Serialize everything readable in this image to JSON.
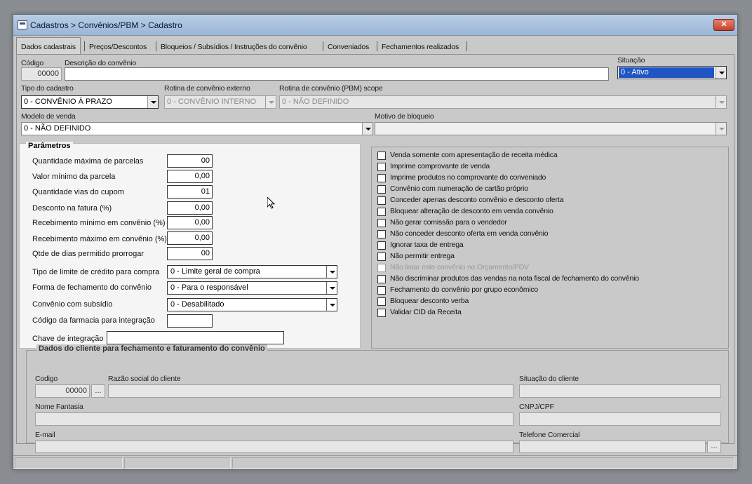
{
  "window": {
    "title": "Cadastros > Convênios/PBM > Cadastro",
    "close": "✕"
  },
  "tabs": [
    {
      "label": "Dados cadastrais"
    },
    {
      "label": "Preços/Descontos"
    },
    {
      "label": "Bloqueios / Subsídios / Instruções do convênio"
    },
    {
      "label": "Conveniados"
    },
    {
      "label": "Fechamentos realizados"
    }
  ],
  "top": {
    "codigo_label": "Código",
    "codigo_value": "00000",
    "descricao_label": "Descrição do convênio",
    "descricao_value": "",
    "situacao_label": "Situação",
    "situacao_value": "0 - Ativo",
    "tipo_label": "Tipo do cadastro",
    "tipo_value": "0 - CONVÊNIO À PRAZO",
    "rotina_ext_label": "Rotina de convênio externo",
    "rotina_ext_value": "0 - CONVÊNIO INTERNO",
    "rotina_pbm_label": "Rotina de convênio (PBM) scope",
    "rotina_pbm_value": "0 - NÃO DEFINIDO",
    "modelo_label": "Modelo de venda",
    "modelo_value": "0 - NÃO DEFINIDO",
    "motivo_label": "Motivo de bloqueio",
    "motivo_value": ""
  },
  "params": {
    "title": "Parâmetros",
    "qtd_parcelas_label": "Quantidade máxima de parcelas",
    "qtd_parcelas_value": "00",
    "valor_min_label": "Valor mínimo da parcela",
    "valor_min_value": "0,00",
    "vias_label": "Quantidade vias do cupom",
    "vias_value": "01",
    "desconto_label": "Desconto na fatura (%)",
    "desconto_value": "0,00",
    "receb_min_label": "Recebimento mínimo em convênio (%)",
    "receb_min_value": "0,00",
    "receb_max_label": "Recebimento máximo em convênio (%)",
    "receb_max_value": "0,00",
    "dias_label": "Qtde de dias permitido prorrogar",
    "dias_value": "00",
    "limite_label": "Tipo de limite de crédito para compra",
    "limite_value": "0 - Limite geral de compra",
    "fechamento_label": "Forma de fechamento do convênio",
    "fechamento_value": "0 - Para o responsável",
    "subsidio_label": "Convênio com subsídio",
    "subsidio_value": "0 - Desabilitado",
    "farmacia_label": "Código da farmacia para integração",
    "farmacia_value": "",
    "chave_label": "Chave de integração",
    "chave_value": ""
  },
  "flags": [
    {
      "label": "Venda somente com apresentação de receita médica"
    },
    {
      "label": "Imprime comprovante de venda"
    },
    {
      "label": "Imprime produtos no comprovante do conveniado"
    },
    {
      "label": "Convênio com numeração de cartão próprio"
    },
    {
      "label": "Conceder apenas desconto convênio e desconto oferta"
    },
    {
      "label": "Bloquear alteração de desconto em venda convênio"
    },
    {
      "label": "Não gerar comissão para o vendedor"
    },
    {
      "label": "Não conceder desconto oferta em venda convênio"
    },
    {
      "label": "Ignorar taxa de entrega"
    },
    {
      "label": "Não permitir entrega"
    },
    {
      "label": "Não listar este convênio no Orçamento/PDV"
    },
    {
      "label": "Não discriminar produtos das vendas na nota fiscal de fechamento do convênio"
    },
    {
      "label": "Fechamento do convênio por grupo econômico"
    },
    {
      "label": "Bloquear desconto verba"
    },
    {
      "label": "Validar CID da Receita"
    }
  ],
  "client": {
    "title": "Dados do cliente para fechamento e faturamento do convênio",
    "codigo_label": "Codigo",
    "codigo_value": "00000",
    "lookup": "...",
    "razao_label": "Razão social do cliente",
    "razao_value": "",
    "situacao_label": "Situação do cliente",
    "situacao_value": "",
    "fantasia_label": "Nome Fantasia",
    "fantasia_value": "",
    "cnpj_label": "CNPJ/CPF",
    "cnpj_value": "",
    "email_label": "E-mail",
    "email_value": "",
    "telefone_label": "Telefone Comercial",
    "telefone_value": "",
    "telefone_btn": "..."
  },
  "colors": {
    "selection": "#1f56c4",
    "panel": "#f5f5f5",
    "chrome": "#c9c9c9"
  }
}
